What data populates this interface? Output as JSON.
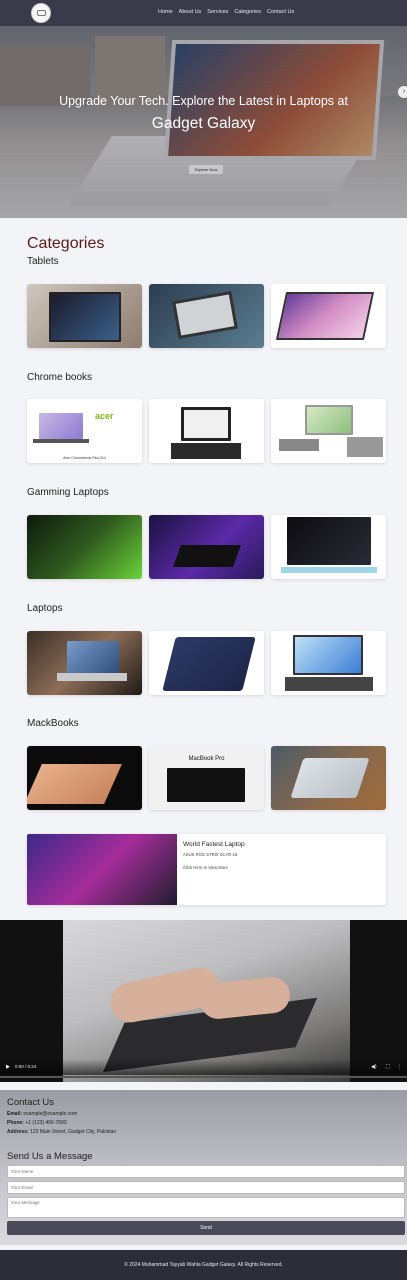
{
  "nav": {
    "links": [
      "Home",
      "About Us",
      "Services",
      "Categories",
      "Contact Us"
    ]
  },
  "hero": {
    "title": "Upgrade Your Tech. Explore the Latest in Laptops at",
    "subtitle": "Gadget Galaxy",
    "button": "Explore Now",
    "next_icon": "chevron-right-icon"
  },
  "categories": {
    "title": "Categories",
    "sections": [
      {
        "label": "Tablets"
      },
      {
        "label": "Chrome books"
      },
      {
        "label": "Gamming Laptops"
      },
      {
        "label": "Laptops"
      },
      {
        "label": "MackBooks"
      }
    ],
    "chromebook_caption": "Acer Chromebook Plus 514",
    "acer_logo": "acer",
    "macbook_logo": "MacBook Pro"
  },
  "feature": {
    "title": "World Fastest Laptop",
    "desc": "ASUS ROG STRIX SCAR 18",
    "link": "Click Here to View More"
  },
  "video": {
    "time": "0:00 / 0:24",
    "play_icon": "play-icon",
    "volume_icon": "volume-icon",
    "fullscreen_icon": "fullscreen-icon",
    "more_icon": "more-options-icon"
  },
  "contact": {
    "title": "Contact Us",
    "email_label": "Email:",
    "email": "example@example.com",
    "phone_label": "Phone:",
    "phone": "+1 (123) 456-7890",
    "address_label": "Address:",
    "address": "123 Main Street, Gadget City, Pakistan",
    "form_title": "Send Us a Message",
    "name_placeholder": "Your Name",
    "email_placeholder": "Your Email",
    "message_placeholder": "Your Message",
    "send": "Send"
  },
  "footer": {
    "text": "© 2024 Muhammad Tayyab Wahla Gadget Galaxy. All Rights Reserved."
  },
  "colors": {
    "navbar": "#3a3b4a",
    "category_title": "#5a1a1a",
    "send_button": "#4a4a5a",
    "footer": "#2d2d3a"
  }
}
